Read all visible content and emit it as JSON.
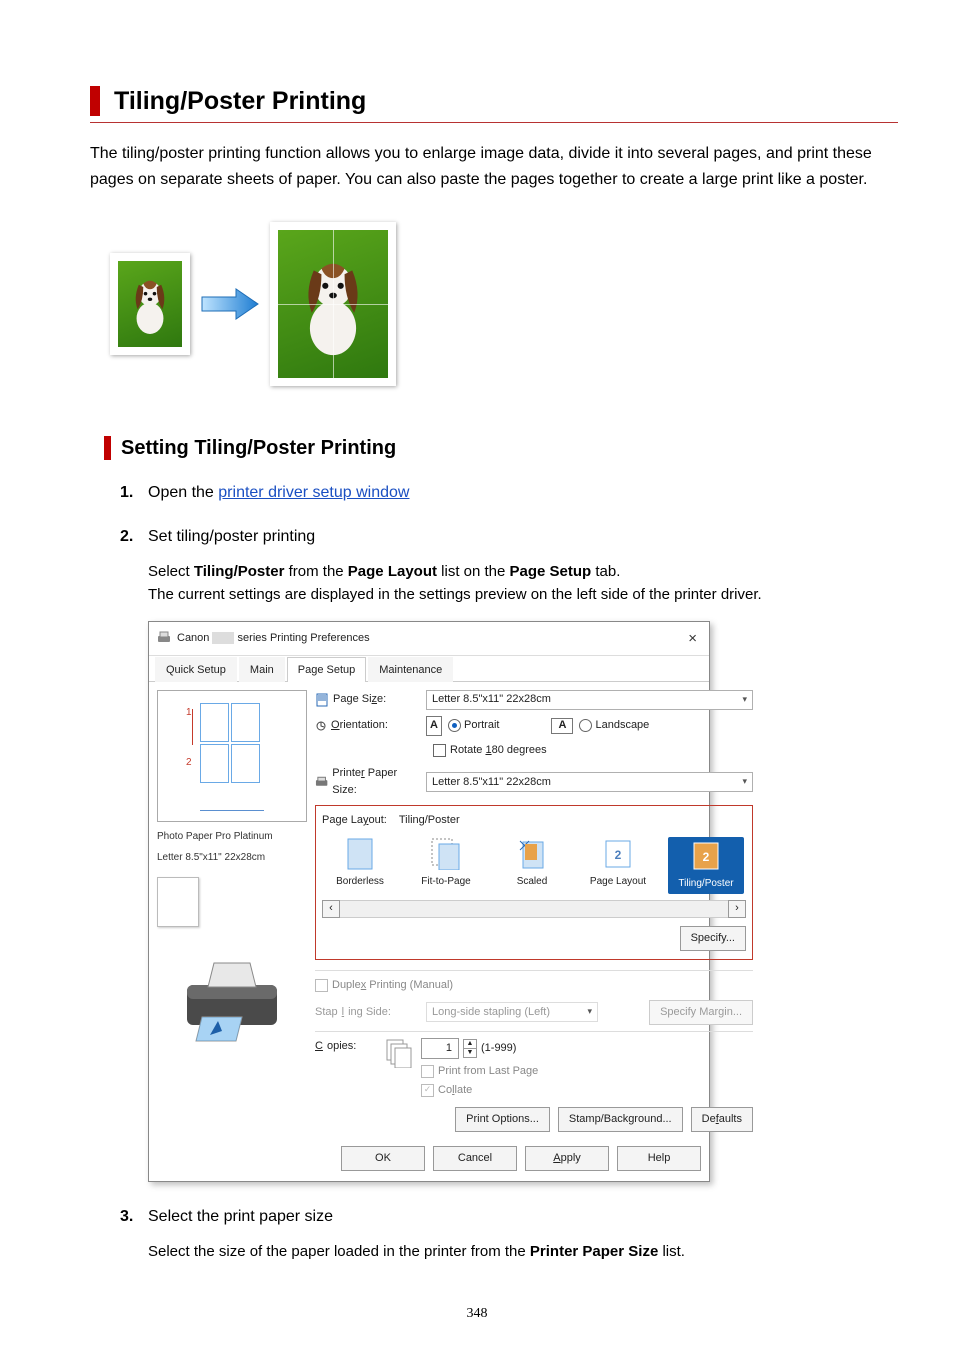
{
  "pageNumber": "348",
  "title": "Tiling/Poster Printing",
  "intro": "The tiling/poster printing function allows you to enlarge image data, divide it into several pages, and print these pages on separate sheets of paper. You can also paste the pages together to create a large print like a poster.",
  "section2": "Setting Tiling/Poster Printing",
  "steps": {
    "s1": {
      "num": "1.",
      "lead": "Open the ",
      "link": "printer driver setup window"
    },
    "s2": {
      "num": "2.",
      "title": "Set tiling/poster printing",
      "desc_a": "Select ",
      "desc_b": "Tiling/Poster",
      "desc_c": " from the ",
      "desc_d": "Page Layout",
      "desc_e": " list on the ",
      "desc_f": "Page Setup",
      "desc_g": " tab.",
      "desc2": "The current settings are displayed in the settings preview on the left side of the printer driver."
    },
    "s3": {
      "num": "3.",
      "title": "Select the print paper size",
      "desc_a": "Select the size of the paper loaded in the printer from the ",
      "desc_b": "Printer Paper Size",
      "desc_c": " list."
    }
  },
  "dialog": {
    "titleBrand": "Canon",
    "titleRest": "series Printing Preferences",
    "close": "×",
    "tabs": {
      "t1": "Quick Setup",
      "t2": "Main",
      "t3": "Page Setup",
      "t4": "Maintenance"
    },
    "preview": {
      "num1": "1",
      "num2": "2",
      "mediaLine1": "Photo Paper Pro Platinum",
      "mediaLine2": "Letter 8.5\"x11\" 22x28cm"
    },
    "labels": {
      "pageSize": "Page Size:",
      "orientation": "Orientation:",
      "portrait": "Portrait",
      "landscape": "Landscape",
      "rotate": "Rotate 180 degrees",
      "printerPaper": "Printer Paper Size:",
      "pageLayout": "Page Layout:",
      "specify": "Specify...",
      "duplex": "Duplex Printing (Manual)",
      "stapling": "Stapling Side:",
      "staplingVal": "Long-side stapling (Left)",
      "specifyMargin": "Specify Margin...",
      "copies": "Copies:",
      "copiesVal": "1",
      "copiesRange": "(1-999)",
      "printLast": "Print from Last Page",
      "collate": "Collate",
      "printOptions": "Print Options...",
      "stampBg": "Stamp/Background...",
      "defaults": "Defaults",
      "ok": "OK",
      "cancel": "Cancel",
      "apply": "Apply",
      "help": "Help"
    },
    "values": {
      "paper": "Letter 8.5\"x11\" 22x28cm",
      "layoutCurrent": "Tiling/Poster"
    },
    "layouts": {
      "l1": "Borderless",
      "l2": "Fit-to-Page",
      "l3": "Scaled",
      "l4": "Page Layout",
      "l5": "Tiling/Poster"
    }
  }
}
